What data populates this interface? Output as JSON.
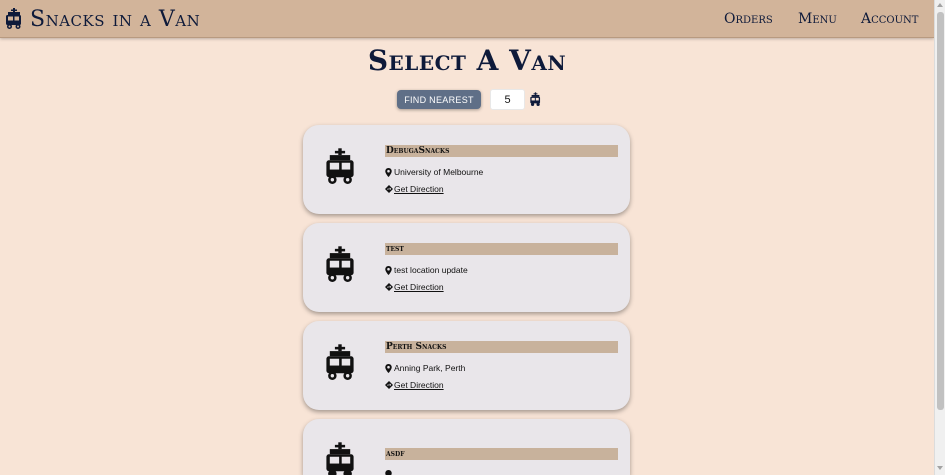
{
  "header": {
    "brand": "Snacks in a Van",
    "nav": [
      "Orders",
      "Menu",
      "Account"
    ]
  },
  "page": {
    "title": "Select A Van",
    "find_button": "FIND NEAREST",
    "count_value": "5"
  },
  "vans": [
    {
      "name": "DebugaSnacks",
      "location": "University of Melbourne",
      "direction": "Get Direction"
    },
    {
      "name": "test",
      "location": "test location update",
      "direction": "Get Direction"
    },
    {
      "name": "Perth Snacks",
      "location": "Anning Park, Perth",
      "direction": "Get Direction"
    },
    {
      "name": "asdf",
      "location": "",
      "direction": ""
    }
  ],
  "colors": {
    "background": "#f8e4d6",
    "header": "#d2b49a",
    "card": "#e9e6ea",
    "name_bar": "#c8b29c",
    "button": "#5f6f87",
    "title": "#0e1a3a"
  },
  "icons": {
    "brand": "van-icon",
    "count": "van-icon",
    "card": "van-icon",
    "location": "map-marker-icon",
    "direction": "direction-diamond-icon"
  }
}
